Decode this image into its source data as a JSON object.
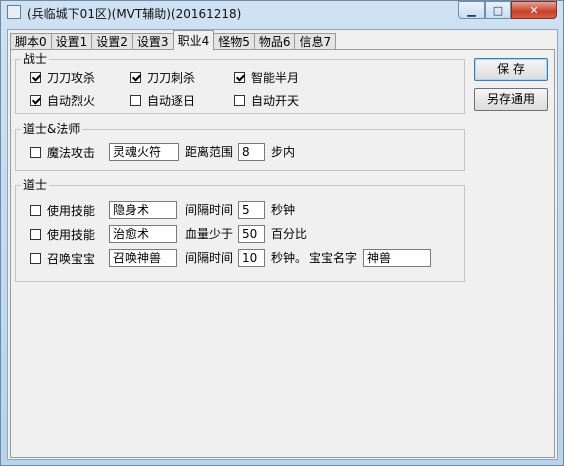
{
  "window": {
    "title": "(兵临城下01区)(MVT辅助)(20161218)",
    "caption": {
      "minimize": "▁",
      "maximize": "□",
      "close": "✕"
    }
  },
  "tabs": [
    "脚本0",
    "设置1",
    "设置2",
    "设置3",
    "职业4",
    "怪物5",
    "物品6",
    "信息7"
  ],
  "active_tab": "职业4",
  "warrior": {
    "title": "战士",
    "options": [
      {
        "label": "刀刀攻杀",
        "checked": true
      },
      {
        "label": "刀刀刺杀",
        "checked": true
      },
      {
        "label": "智能半月",
        "checked": true
      },
      {
        "label": "自动烈火",
        "checked": true
      },
      {
        "label": "自动逐日",
        "checked": false
      },
      {
        "label": "自动开天",
        "checked": false
      }
    ]
  },
  "taoist_mage": {
    "title": "道士&法师",
    "magic_attack": {
      "label": "魔法攻击",
      "checked": false,
      "value": "灵魂火符"
    },
    "distance_label": "距离范围",
    "distance_value": "8",
    "distance_unit": "步内"
  },
  "taoist": {
    "title": "道士",
    "rows": [
      {
        "label": "使用技能",
        "checked": false,
        "skill": "隐身术",
        "param_label": "间隔时间",
        "param_value": "5",
        "unit": "秒钟"
      },
      {
        "label": "使用技能",
        "checked": false,
        "skill": "治愈术",
        "param_label": "血量少于",
        "param_value": "50",
        "unit": "百分比"
      },
      {
        "label": "召唤宝宝",
        "checked": false,
        "skill": "召唤神兽",
        "param_label": "间隔时间",
        "param_value": "10",
        "unit": "秒钟。",
        "pet_label": "宝宝名字",
        "pet_value": "神兽"
      }
    ]
  },
  "buttons": {
    "save": "保 存",
    "save_as_default": "另存通用"
  }
}
